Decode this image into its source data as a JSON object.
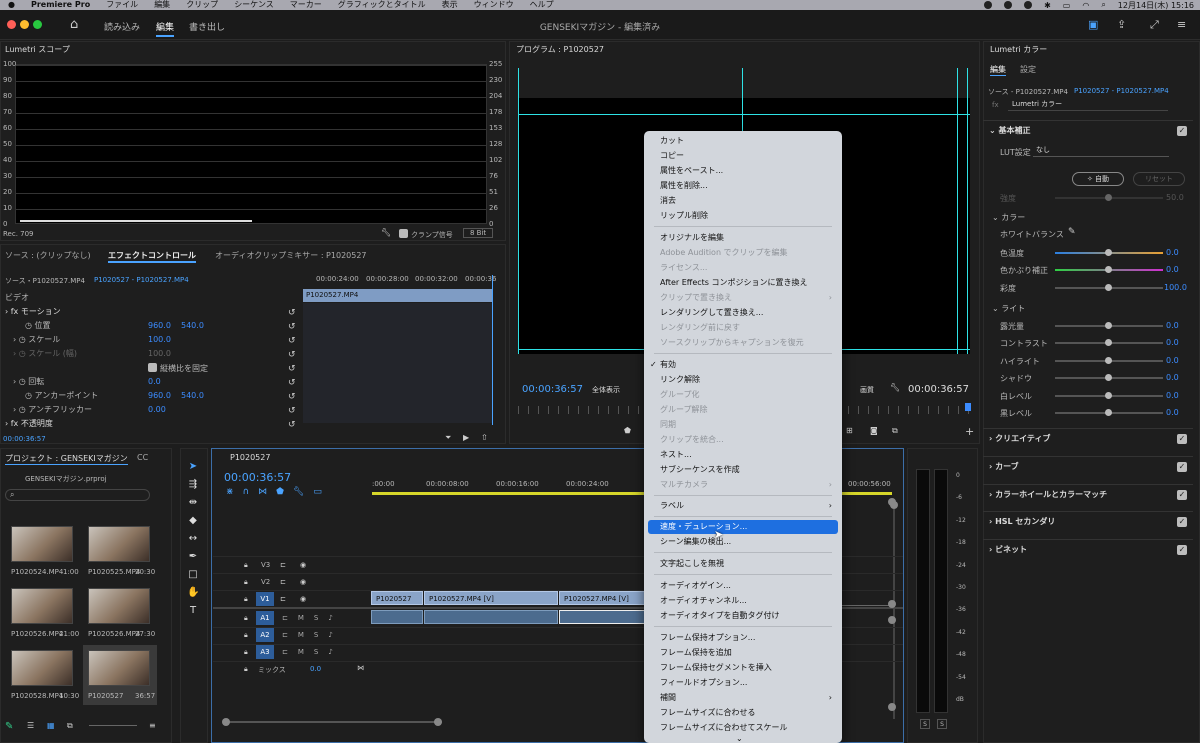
{
  "menubar": {
    "apple": "",
    "app_name": "Premiere Pro",
    "items": [
      "ファイル",
      "編集",
      "クリップ",
      "シーケンス",
      "マーカー",
      "グラフィックとタイトル",
      "表示",
      "ウィンドウ",
      "ヘルプ"
    ],
    "datetime": "12月14日(木)  15:16"
  },
  "titlebar": {
    "workspaces": [
      "読み込み",
      "編集",
      "書き出し"
    ],
    "active_workspace": "編集",
    "window_title": "GENSEKIマガジン - 編集済み"
  },
  "scope": {
    "title": "Lumetri スコープ",
    "left_ticks": [
      "100",
      "90",
      "80",
      "70",
      "60",
      "50",
      "40",
      "30",
      "20",
      "10",
      "0"
    ],
    "right_ticks": [
      "255",
      "230",
      "204",
      "178",
      "153",
      "128",
      "102",
      "76",
      "51",
      "26",
      "0"
    ],
    "footer_left": "Rec. 709",
    "clamp_label": "クランプ信号",
    "bit_depth": "8 Bit"
  },
  "effect_panel": {
    "tabs": [
      "ソース : (クリップなし)",
      "エフェクトコントロール",
      "オーディオクリップミキサー : P1020527"
    ],
    "source_label": "ソース・P1020527.MP4",
    "sequence_label": "P1020527 - P1020527.MP4",
    "timecodes": [
      "00:00:24:00",
      "00:00:28:00",
      "00:00:32:00",
      "00:00:36"
    ],
    "clip_name": "P1020527.MP4",
    "video_header": "ビデオ",
    "rows": [
      {
        "label": "モーション",
        "v1": "",
        "v2": ""
      },
      {
        "label": "位置",
        "v1": "960.0",
        "v2": "540.0"
      },
      {
        "label": "スケール",
        "v1": "100.0",
        "v2": ""
      },
      {
        "label": "スケール (幅)",
        "v1": "100.0",
        "v2": ""
      },
      {
        "label": "縦横比を固定",
        "v1": "",
        "v2": ""
      },
      {
        "label": "回転",
        "v1": "0.0",
        "v2": ""
      },
      {
        "label": "アンカーポイント",
        "v1": "960.0",
        "v2": "540.0"
      },
      {
        "label": "アンチフリッカー",
        "v1": "0.00",
        "v2": ""
      },
      {
        "label": "不透明度",
        "v1": "",
        "v2": ""
      }
    ],
    "footer_timecode": "00:00:36:57"
  },
  "program": {
    "title": "プログラム : P1020527",
    "timecode": "00:00:36:57",
    "fit": "全体表示",
    "quality": "画質",
    "end_timecode": "00:00:36:57"
  },
  "project": {
    "title": "プロジェクト : GENSEKIマガジン",
    "tab2": "CC",
    "file": "GENSEKIマガジン.prproj",
    "items": [
      {
        "name": "P1020524.MP4",
        "dur": "1:00"
      },
      {
        "name": "P1020525.MP4",
        "dur": "20:30"
      },
      {
        "name": "P1020526.MP4",
        "dur": "21:00"
      },
      {
        "name": "P1020526.MP4",
        "dur": "27:30"
      },
      {
        "name": "P1020528.MP4",
        "dur": "10:30"
      },
      {
        "name": "P1020527",
        "dur": "36:57"
      }
    ]
  },
  "timeline": {
    "tab": "P1020527",
    "timecode": "00:00:36:57",
    "ruler": [
      ":00:00",
      "00:00:08:00",
      "00:00:16:00",
      "00:00:24:00",
      "00:00:56:00"
    ],
    "tracks": [
      "V3",
      "V2",
      "V1",
      "A1",
      "A2",
      "A3"
    ],
    "mix_label": "ミックス",
    "mix_value": "0.0",
    "clips": [
      "P1020527",
      "P1020527.MP4 [V]",
      "P1020527.MP4 [V]"
    ]
  },
  "meter": {
    "ticks": [
      "0",
      "-6",
      "-12",
      "-18",
      "-24",
      "-30",
      "-36",
      "-42",
      "-48",
      "-54",
      "dB"
    ]
  },
  "lumetri": {
    "title": "Lumetri カラー",
    "tabs": [
      "編集",
      "設定"
    ],
    "source": "ソース - P1020527.MP4",
    "sequence": "P1020527 - P1020527.MP4",
    "effect_name": "Lumetri カラー",
    "basic": "基本補正",
    "lut_label": "LUT設定",
    "lut_value": "なし",
    "auto_btn": "自動",
    "reset_btn": "リセット",
    "intensity_label": "強度",
    "intensity_value": "50.0",
    "color_header": "カラー",
    "wb_label": "ホワイトバランス",
    "temp_label": "色温度",
    "temp_value": "0.0",
    "tint_label": "色かぶり補正",
    "tint_value": "0.0",
    "sat_label": "彩度",
    "sat_value": "100.0",
    "light_header": "ライト",
    "light_rows": [
      {
        "label": "露光量",
        "value": "0.0"
      },
      {
        "label": "コントラスト",
        "value": "0.0"
      },
      {
        "label": "ハイライト",
        "value": "0.0"
      },
      {
        "label": "シャドウ",
        "value": "0.0"
      },
      {
        "label": "白レベル",
        "value": "0.0"
      },
      {
        "label": "黒レベル",
        "value": "0.0"
      }
    ],
    "sections": [
      "クリエイティブ",
      "カーブ",
      "カラーホイールとカラーマッチ",
      "HSL セカンダリ",
      "ビネット"
    ]
  },
  "context_menu": {
    "items": [
      {
        "label": "カット",
        "state": "enabled"
      },
      {
        "label": "コピー",
        "state": "enabled"
      },
      {
        "label": "属性をペースト...",
        "state": "enabled"
      },
      {
        "label": "属性を削除...",
        "state": "enabled"
      },
      {
        "label": "消去",
        "state": "enabled"
      },
      {
        "label": "リップル削除",
        "state": "enabled"
      },
      {
        "label": "オリジナルを編集",
        "state": "enabled"
      },
      {
        "label": "Adobe Audition でクリップを編集",
        "state": "disabled"
      },
      {
        "label": "ライセンス...",
        "state": "disabled"
      },
      {
        "label": "After Effects コンポジションに置き換え",
        "state": "enabled"
      },
      {
        "label": "クリップで置き換え",
        "state": "disabled"
      },
      {
        "label": "レンダリングして置き換え...",
        "state": "enabled"
      },
      {
        "label": "レンダリング前に戻す",
        "state": "disabled"
      },
      {
        "label": "ソースクリップからキャプションを復元",
        "state": "disabled"
      },
      {
        "label": "有効",
        "state": "enabled"
      },
      {
        "label": "リンク解除",
        "state": "enabled"
      },
      {
        "label": "グループ化",
        "state": "disabled"
      },
      {
        "label": "グループ解除",
        "state": "disabled"
      },
      {
        "label": "同期",
        "state": "disabled"
      },
      {
        "label": "クリップを統合...",
        "state": "disabled"
      },
      {
        "label": "ネスト...",
        "state": "enabled"
      },
      {
        "label": "サブシーケンスを作成",
        "state": "enabled"
      },
      {
        "label": "マルチカメラ",
        "state": "disabled"
      },
      {
        "label": "ラベル",
        "state": "enabled"
      },
      {
        "label": "速度・デュレーション...",
        "state": "highlighted"
      },
      {
        "label": "シーン編集の検出...",
        "state": "enabled"
      },
      {
        "label": "文字起こしを無視",
        "state": "enabled"
      },
      {
        "label": "オーディオゲイン...",
        "state": "enabled"
      },
      {
        "label": "オーディオチャンネル...",
        "state": "enabled"
      },
      {
        "label": "オーディオタイプを自動タグ付け",
        "state": "enabled"
      },
      {
        "label": "フレーム保持オプション...",
        "state": "enabled"
      },
      {
        "label": "フレーム保持を追加",
        "state": "enabled"
      },
      {
        "label": "フレーム保持セグメントを挿入",
        "state": "enabled"
      },
      {
        "label": "フィールドオプション...",
        "state": "enabled"
      },
      {
        "label": "補間",
        "state": "enabled"
      },
      {
        "label": "フレームサイズに合わせる",
        "state": "enabled"
      },
      {
        "label": "フレームサイズに合わせてスケール",
        "state": "enabled"
      }
    ]
  }
}
